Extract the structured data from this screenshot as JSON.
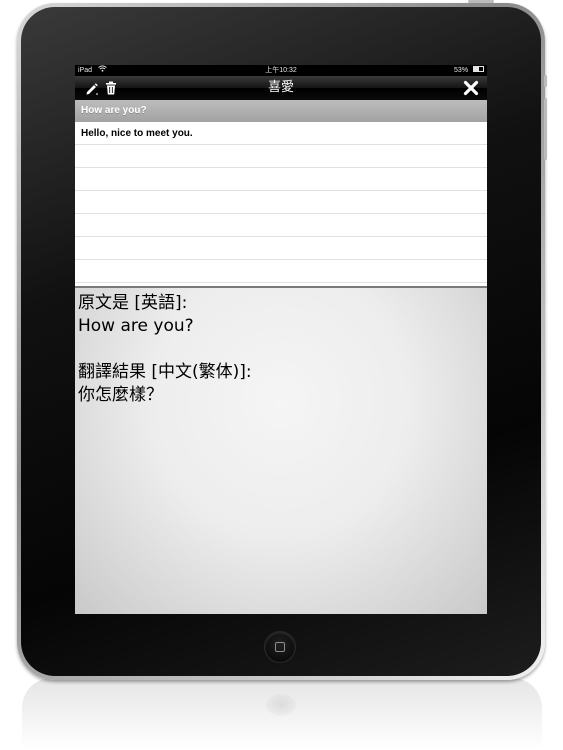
{
  "status_bar": {
    "device": "iPad",
    "time": "上午10:32",
    "battery": "53%"
  },
  "nav_bar": {
    "title": "喜愛",
    "left_icons": [
      "pencil-icon",
      "trash-icon"
    ],
    "right_icon": "close-icon"
  },
  "section_header": "How are you?",
  "list": {
    "items": [
      "Hello, nice to meet you.",
      "",
      "",
      "",
      "",
      "",
      ""
    ]
  },
  "detail": {
    "source_label": "原文是 [英語]:",
    "source_text": "How are you?",
    "result_label": "翻譯結果 [中文(繁体)]:",
    "result_text": "你怎麼樣？"
  },
  "colors": {
    "navbar": "#141414",
    "section_header": "#aaaaaa",
    "list_bg": "#ffffff",
    "detail_bg": "#ececec"
  }
}
